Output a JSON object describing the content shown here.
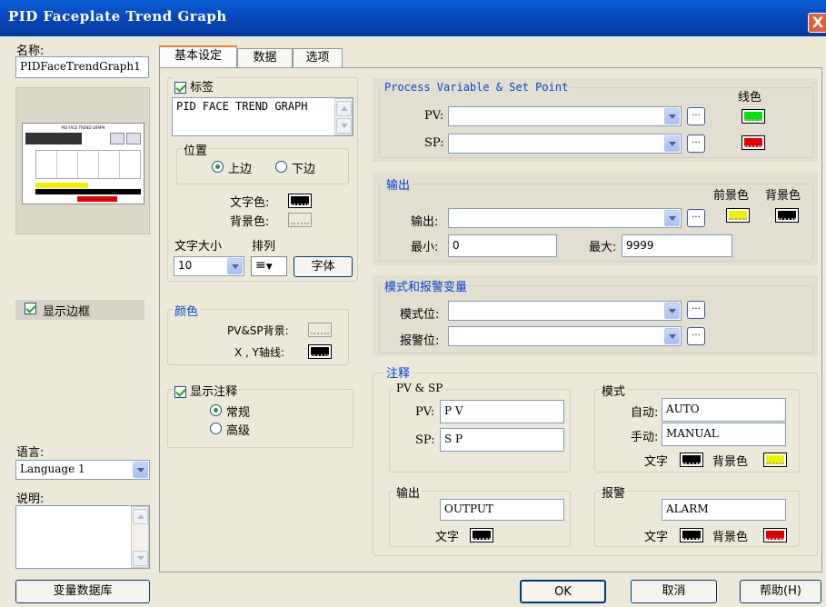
{
  "window": {
    "title": "PID Faceplate Trend Graph",
    "close_glyph": "X"
  },
  "left": {
    "name_label": "名称:",
    "name_value": "PIDFaceTrendGraph1",
    "preview_title": "PID FACE TREND GRAPH",
    "show_border_label": "显示边框",
    "language_label": "语言:",
    "language_value": "Language 1",
    "description_label": "说明:",
    "tagdb_button": "变量数据库"
  },
  "tabs": [
    {
      "label": "基本设定"
    },
    {
      "label": "数据"
    },
    {
      "label": "选项"
    }
  ],
  "basic": {
    "label_check": "标签",
    "label_text": "PID FACE TREND GRAPH",
    "position_label": "位置",
    "pos_top": "上边",
    "pos_bottom": "下边",
    "text_color_label": "文字色:",
    "bg_color_label": "背景色:",
    "font_size_label": "文字大小",
    "align_label": "排列",
    "font_size_value": "10",
    "font_button": "字体",
    "color_group": "颜色",
    "pvsp_bg_label": "PV&SP背景:",
    "xy_axis_label": "X , Y轴线:",
    "show_note_label": "显示注释",
    "note_normal": "常规",
    "note_advanced": "高级"
  },
  "pvsp": {
    "title": "Process Variable & Set Point",
    "line_color_label": "线色",
    "pv_label": "PV:",
    "sp_label": "SP:",
    "dots": "..."
  },
  "output": {
    "title": "输出",
    "fg_label": "前景色",
    "bg_label": "背景色",
    "output_label": "输出:",
    "min_label": "最小:",
    "min_value": "0",
    "max_label": "最大:",
    "max_value": "9999"
  },
  "mode_alarm": {
    "title": "模式和报警变量",
    "mode_bit_label": "模式位:",
    "alarm_bit_label": "报警位:"
  },
  "notes": {
    "title": "注释",
    "pvsp_group": "PV & SP",
    "pv_label": "PV:",
    "pv_value": "P V",
    "sp_label": "SP:",
    "sp_value": "S P",
    "mode_group": "模式",
    "auto_label": "自动:",
    "auto_value": "AUTO",
    "manual_label": "手动:",
    "manual_value": "MANUAL",
    "text_label": "文字",
    "bg_label": "背景色",
    "output_group": "输出",
    "output_value": "OUTPUT",
    "alarm_group": "报警",
    "alarm_value": "ALARM"
  },
  "buttons": {
    "ok": "OK",
    "cancel": "取消",
    "help": "帮助(H)"
  },
  "colors": {
    "pv_line": "#00e600",
    "sp_line": "#e60000",
    "fg_yellow": "#f0f000",
    "black": "#000000",
    "alarm_red": "#e00000"
  }
}
